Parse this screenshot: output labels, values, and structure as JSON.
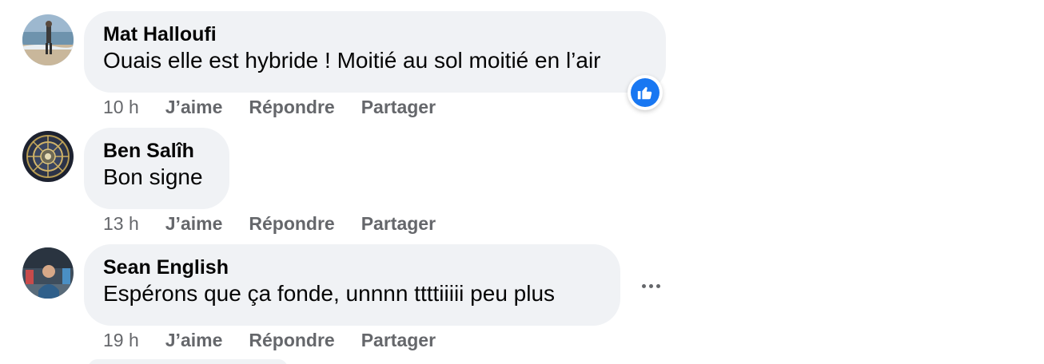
{
  "comments": [
    {
      "author": "Mat Halloufi",
      "text": "Ouais elle est hybride ! Moitié au sol moitié en l’air",
      "time": "10 h",
      "actions": {
        "like": "J’aime",
        "reply": "Répondre",
        "share": "Partager"
      },
      "reaction": "like-icon"
    },
    {
      "author": "Ben Salîh",
      "text": "Bon signe",
      "time": "13 h",
      "actions": {
        "like": "J’aime",
        "reply": "Répondre",
        "share": "Partager"
      }
    },
    {
      "author": "Sean English",
      "text": "Espérons que ça fonde, unnnn ttttiiiii peu plus",
      "time": "19 h",
      "actions": {
        "like": "J’aime",
        "reply": "Répondre",
        "share": "Partager"
      },
      "more_icon": "more-horizontal-icon"
    }
  ],
  "colors": {
    "bubble": "#f0f2f5",
    "secondary_text": "#65676b",
    "like_blue": "#1877f2"
  }
}
